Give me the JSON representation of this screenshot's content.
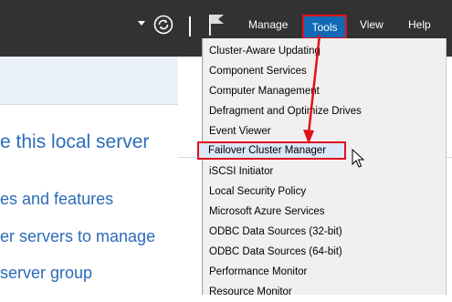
{
  "topbar": {
    "menus": {
      "manage": "Manage",
      "tools": "Tools",
      "view": "View",
      "help": "Help"
    },
    "icons": [
      "dropdown-arrow-icon",
      "refresh-icon",
      "flag-icon"
    ]
  },
  "welcome": {
    "line1": "e this local server",
    "line2": "es and features",
    "line3": "er servers to manage",
    "line4": " server group"
  },
  "tools_menu": {
    "items": [
      "Cluster-Aware Updating",
      "Component Services",
      "Computer Management",
      "Defragment and Optimize Drives",
      "Event Viewer",
      "Failover Cluster Manager",
      "iSCSI Initiator",
      "Local Security Policy",
      "Microsoft Azure Services",
      "ODBC Data Sources (32-bit)",
      "ODBC Data Sources (64-bit)",
      "Performance Monitor",
      "Resource Monitor"
    ],
    "highlighted_item": "Failover Cluster Manager"
  },
  "colors": {
    "topbar": "#323232",
    "accent_blue": "#0f69b4",
    "annotation_red": "#e0111b",
    "link_blue": "#2a6cb8",
    "menu_bg": "#f0f0f0"
  }
}
